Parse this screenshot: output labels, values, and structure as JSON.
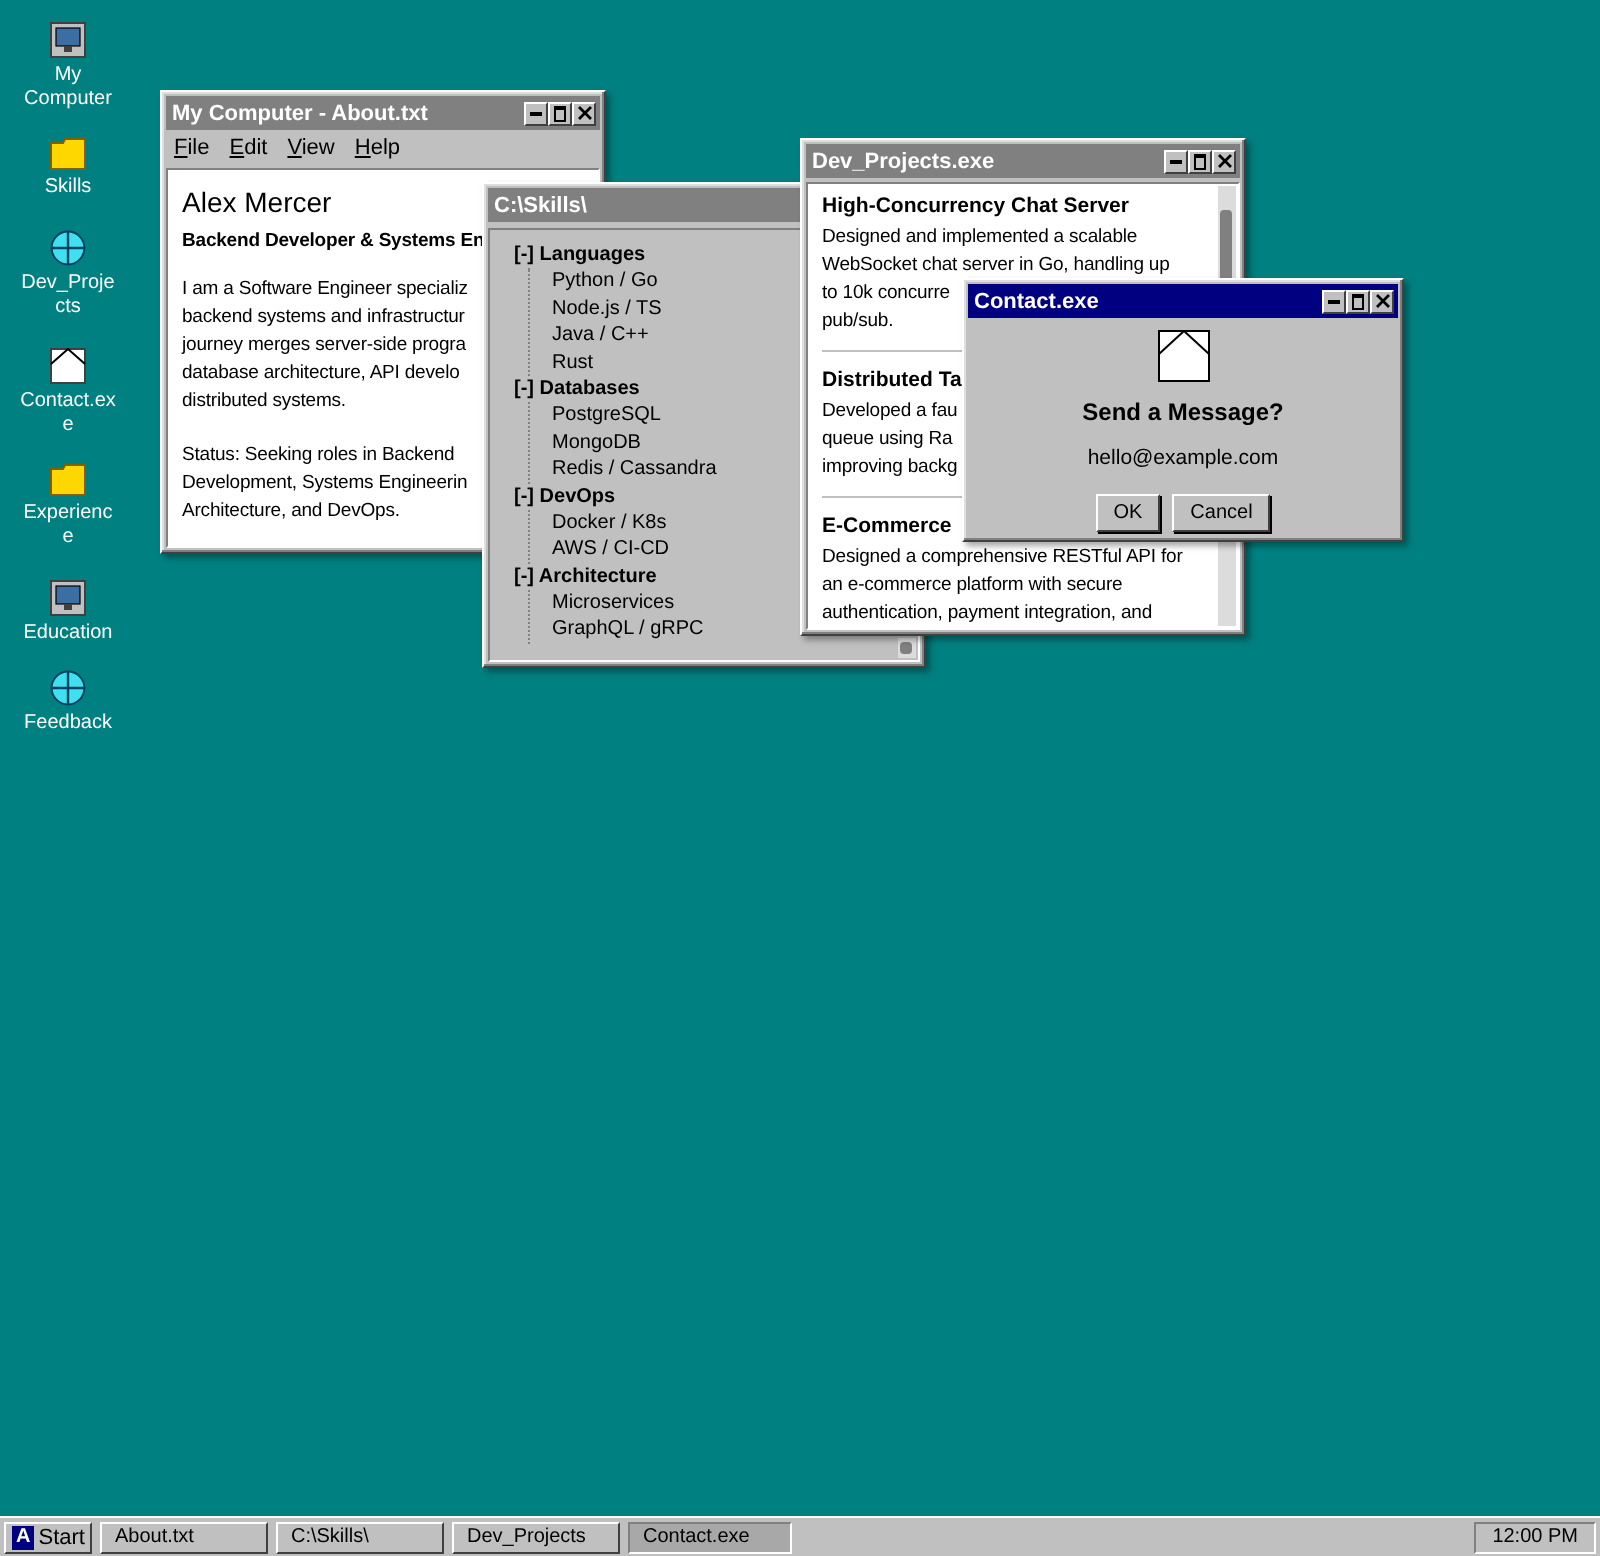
{
  "desktop_icons": [
    {
      "label": "My Computer",
      "kind": "computer"
    },
    {
      "label": "Skills",
      "kind": "folder"
    },
    {
      "label": "Dev_Projects",
      "kind": "globe"
    },
    {
      "label": "Contact.exe",
      "kind": "mail"
    },
    {
      "label": "Experience",
      "kind": "folder"
    },
    {
      "label": "Education",
      "kind": "computer"
    },
    {
      "label": "Feedback",
      "kind": "globe"
    }
  ],
  "windows": [
    {
      "kind": "about",
      "title": "My Computer - About.txt",
      "active": false,
      "menu": [
        "File",
        "Edit",
        "View",
        "Help"
      ],
      "name": "Alex Mercer",
      "role": "Backend Developer & Systems En",
      "paragraphs": [
        [
          "I am a Software Engineer specializ",
          "backend systems and infrastructur",
          "journey merges server-side progra",
          "database architecture, API develo",
          "distributed systems."
        ],
        [
          "Status: Seeking roles in Backend",
          "Development, Systems Engineerin",
          "Architecture, and DevOps."
        ]
      ]
    },
    {
      "kind": "skills",
      "title": "C:\\Skills\\",
      "active": false,
      "tree": [
        {
          "marker": "[-]",
          "label": "Languages",
          "expanded": true,
          "children": [
            {
              "label": "Python / Go"
            },
            {
              "label": "Node.js / TS"
            },
            {
              "label": "Java / C++"
            },
            {
              "label": "Rust"
            }
          ]
        },
        {
          "marker": "[-]",
          "label": "Databases",
          "expanded": true,
          "children": [
            {
              "label": "PostgreSQL"
            },
            {
              "label": "MongoDB"
            },
            {
              "label": "Redis / Cassandra"
            }
          ]
        },
        {
          "marker": "[-]",
          "label": "DevOps",
          "expanded": true,
          "children": [
            {
              "label": "Docker / K8s"
            },
            {
              "label": "AWS / CI-CD"
            }
          ]
        },
        {
          "marker": "[-]",
          "label": "Architecture",
          "expanded": true,
          "children": [
            {
              "label": "Microservices"
            },
            {
              "label": "GraphQL / gRPC"
            }
          ]
        }
      ]
    },
    {
      "kind": "projects",
      "title": "Dev_Projects.exe",
      "active": false,
      "projects": [
        {
          "title": "High-Concurrency Chat Server",
          "lines": [
            "Designed and implemented a scalable",
            "WebSocket chat server in Go, handling up",
            "to 10k concurre",
            "pub/sub."
          ]
        },
        {
          "title": "Distributed Ta",
          "lines": [
            "Developed a fau",
            "queue using Ra",
            "improving backg"
          ]
        },
        {
          "title": "E-Commerce",
          "lines": [
            "Designed a comprehensive RESTful API for",
            "an e-commerce platform with secure",
            "authentication, payment integration, and"
          ]
        }
      ]
    },
    {
      "kind": "dialog",
      "title": "Contact.exe",
      "active": true,
      "heading": "Send a Message?",
      "email": "hello@example.com",
      "buttons": [
        "OK",
        "Cancel"
      ]
    }
  ],
  "taskbar": {
    "start": {
      "logo": "A",
      "label": "Start"
    },
    "tasks": [
      {
        "label": "About.txt",
        "selected": false
      },
      {
        "label": "C:\\Skills\\",
        "selected": false
      },
      {
        "label": "Dev_Projects",
        "selected": false
      },
      {
        "label": "Contact.exe",
        "selected": true
      }
    ],
    "clock": "12:00 PM"
  }
}
